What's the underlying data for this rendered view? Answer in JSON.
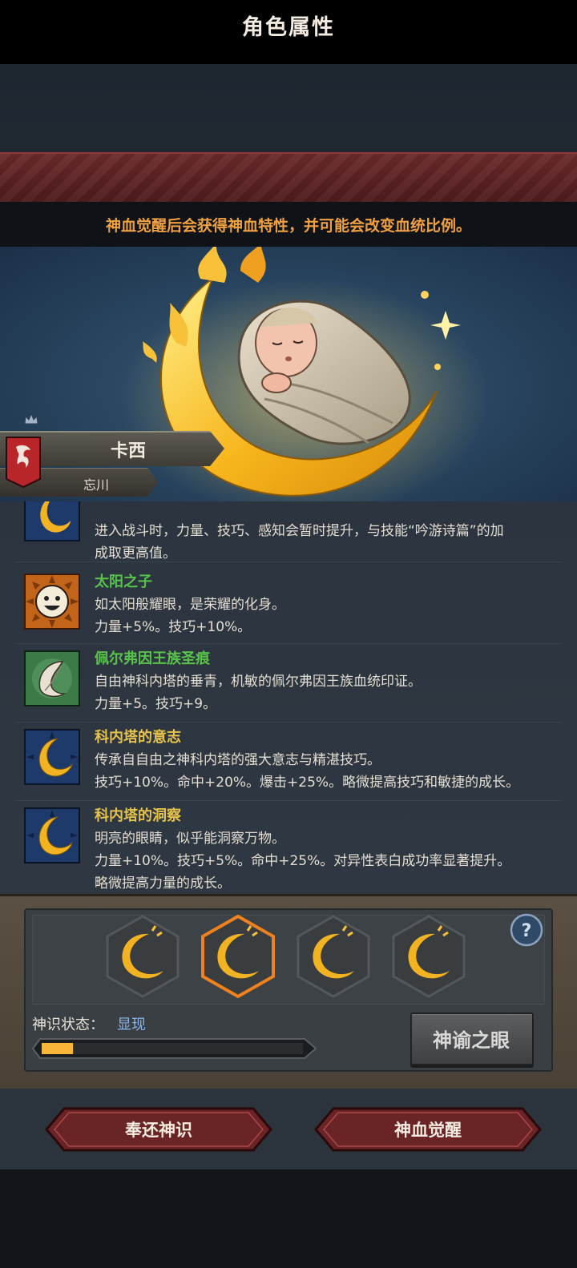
{
  "header": {
    "title": "角色属性",
    "notice": "神血觉醒后会获得神血特性，并可能会改变血统比例。"
  },
  "character": {
    "name": "卡西",
    "subtitle": "忘川"
  },
  "traits": [
    {
      "name": "",
      "icon": "moon-icon",
      "lines": [
        "进入战斗时，力量、技巧、感知会暂时提升，与技能“吟游诗篇”的加",
        "成取更高值。"
      ]
    },
    {
      "name": "太阳之子",
      "name_color": "#58c24a",
      "icon": "sun-face-icon",
      "lines": [
        "如太阳般耀眼，是荣耀的化身。",
        "力量+5%。技巧+10%。"
      ]
    },
    {
      "name": "佩尔弗因王族圣痕",
      "name_color": "#58c24a",
      "icon": "feather-icon",
      "lines": [
        "自由神科内塔的垂青，机敏的佩尔弗因王族血统印证。",
        "力量+5。技巧+9。"
      ]
    },
    {
      "name": "科内塔的意志",
      "name_color": "#e7c24a",
      "icon": "moon-icon",
      "lines": [
        "传承自自由之神科内塔的强大意志与精湛技巧。",
        "技巧+10%。命中+20%。爆击+25%。略微提高技巧和敏捷的成长。"
      ]
    },
    {
      "name": "科内塔的洞察",
      "name_color": "#e7c24a",
      "icon": "moon-icon",
      "lines": [
        "明亮的眼睛，似乎能洞察万物。",
        "力量+10%。技巧+5%。命中+25%。对异性表白成功率显著提升。",
        "略微提高力量的成长。"
      ]
    }
  ],
  "awakening": {
    "slots": [
      {
        "icon": "crescent-moon-icon",
        "selected": false
      },
      {
        "icon": "crescent-moon-icon",
        "selected": true
      },
      {
        "icon": "crescent-moon-icon",
        "selected": false
      },
      {
        "icon": "crescent-moon-icon",
        "selected": false
      }
    ],
    "state_label": "神识状态：",
    "state_value": "显现",
    "progress": 0.12,
    "oracle_button": "神谕之眼",
    "help_icon": "question-icon"
  },
  "actions": {
    "return_label": "奉还神识",
    "awaken_label": "神血觉醒"
  },
  "colors": {
    "title_red": "#5e2224",
    "notice_orange": "#f0a040",
    "moon_gold": "#f2b322",
    "selected_orange": "#f0821e"
  }
}
